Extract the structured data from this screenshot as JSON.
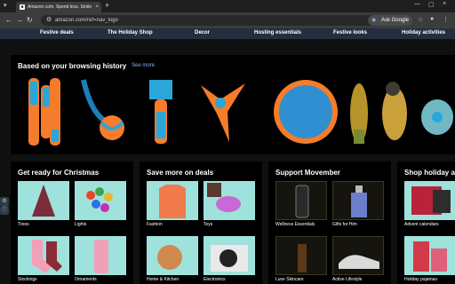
{
  "browser": {
    "tab_title": "Amazon.com. Spend less. Smile",
    "url": "amazon.com/ref=nav_logo",
    "ask_google": "Ask Google",
    "new_tab": "+",
    "tab_close": "×",
    "minimize": "—",
    "restore": "▢",
    "close": "×"
  },
  "subnav": {
    "items": [
      "Festive deals",
      "The Holiday Shop",
      "Decor",
      "Hosting essentials",
      "Festive looks",
      "Holiday activities"
    ]
  },
  "history": {
    "title": "Based on your browsing history",
    "see_more": "See more"
  },
  "cards": [
    {
      "title": "Get ready for Christmas",
      "tiles": [
        {
          "label": "Trees"
        },
        {
          "label": "Lights"
        },
        {
          "label": "Stockings"
        },
        {
          "label": "Ornaments"
        }
      ]
    },
    {
      "title": "Save more on deals",
      "tiles": [
        {
          "label": "Fashion"
        },
        {
          "label": "Toys"
        },
        {
          "label": "Home & Kitchen"
        },
        {
          "label": "Electronics"
        }
      ]
    },
    {
      "title": "Support Movember",
      "tiles": [
        {
          "label": "Wellness Essentials"
        },
        {
          "label": "Gifts for Him"
        },
        {
          "label": "Luxe Skincare"
        },
        {
          "label": "Active Lifestyle"
        }
      ]
    },
    {
      "title": "Shop holiday a",
      "tiles": [
        {
          "label": "Advent calendars"
        },
        {
          "label": ""
        },
        {
          "label": "Holiday pajamas"
        },
        {
          "label": ""
        }
      ]
    }
  ],
  "colors": {
    "accent_orange": "#f57c2b",
    "accent_blue": "#2aa6d8",
    "tile_teal": "#9fe2db",
    "link_blue": "#8ab4f8"
  }
}
